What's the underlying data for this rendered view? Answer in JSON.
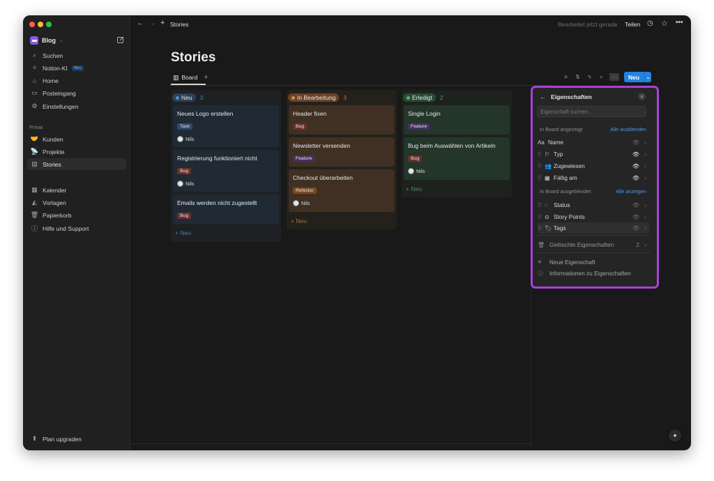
{
  "sidebar": {
    "workspace": "Blog",
    "search": "Suchen",
    "notion_ai": "Notion-KI",
    "notion_ai_badge": "Neu",
    "home": "Home",
    "inbox": "Posteingang",
    "settings": "Einstellungen",
    "private_label": "Privat",
    "pages": [
      "Kunden",
      "Projekte",
      "Stories"
    ],
    "calendar": "Kalender",
    "templates": "Vorlagen",
    "trash": "Papierkorb",
    "help": "Hilfe und Support",
    "upgrade": "Plan upgraden"
  },
  "topbar": {
    "breadcrumb": "Stories",
    "edited": "Bearbeitet jetzt gerade",
    "share": "Teilen"
  },
  "page": {
    "title": "Stories",
    "view_tab": "Board",
    "new_button": "Neu"
  },
  "board": {
    "add_label": "+ Neu",
    "columns": [
      {
        "name": "Neu",
        "count": "3",
        "color": "#2f5d8a",
        "cards": [
          {
            "title": "Neues Logo erstellen",
            "tag": "Task",
            "person": "Nils"
          },
          {
            "title": "Registrierung funktioniert nicht",
            "tag": "Bug",
            "person": "Nils"
          },
          {
            "title": "Emails werden nicht zugestellt",
            "tag": "Bug",
            "person": ""
          }
        ]
      },
      {
        "name": "In Bearbeitung",
        "count": "3",
        "color": "#8c5a2c",
        "cards": [
          {
            "title": "Header fixen",
            "tag": "Bug",
            "person": ""
          },
          {
            "title": "Newsletter versenden",
            "tag": "Feature",
            "person": ""
          },
          {
            "title": "Checkout überarbeiten",
            "tag": "Refector",
            "person": "Nils"
          }
        ]
      },
      {
        "name": "Erledigt",
        "count": "2",
        "color": "#2f6b46",
        "cards": [
          {
            "title": "Single Login",
            "tag": "Feature",
            "person": ""
          },
          {
            "title": "Bug beim Auswählen von Artikeln",
            "tag": "Bug",
            "person": "Nils"
          }
        ]
      }
    ]
  },
  "panel": {
    "title": "Eigenschaften",
    "search_placeholder": "Eigenschaft suchen...",
    "shown_label": "In Board angezeigt",
    "hide_all": "Alle ausblenden",
    "shown": [
      "Name",
      "Typ",
      "Zugewiesen",
      "Fällig am"
    ],
    "hidden_label": "In Board ausgeblendet",
    "show_all": "Alle anzeigen",
    "hidden": [
      "Status",
      "Story Points",
      "Tags"
    ],
    "deleted": "Gelöschte Eigenschaften",
    "deleted_count": "2",
    "new_property": "Neue Eigenschaft",
    "info": "Informationen zu Eigenschaften"
  },
  "colors": {
    "accent": "#2383e2",
    "highlight": "#a942dd"
  }
}
